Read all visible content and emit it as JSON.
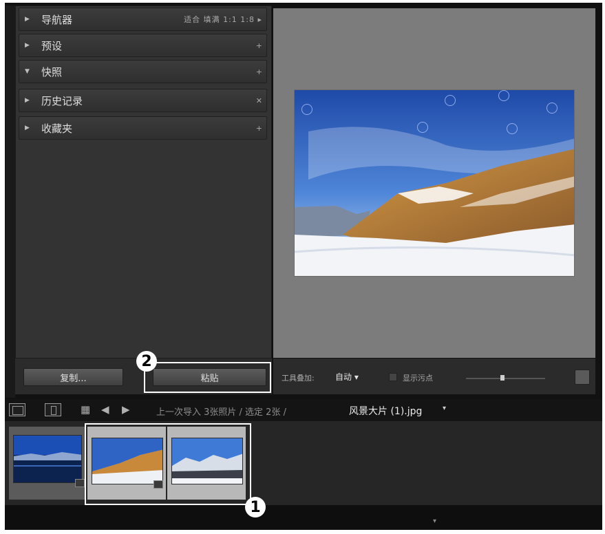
{
  "panels": [
    {
      "label": "导航器",
      "right": "适合 填满 1:1 1:8 ▸"
    },
    {
      "label": "预设",
      "right": "+"
    },
    {
      "label": "快照",
      "right": "+"
    },
    {
      "label": "历史记录",
      "right": "✕"
    },
    {
      "label": "收藏夹",
      "right": "+"
    }
  ],
  "left_toolbar": {
    "copy_label": "复制...",
    "paste_label": "粘贴"
  },
  "preview_toolbar": {
    "tool_label": "工具叠加:",
    "tool_value": "自动 ▾",
    "checkbox_label": "显示污点",
    "grid_icon": "grid-icon"
  },
  "filmstrip_header": {
    "path": "上一次导入 3张照片 / 选定 2张 /",
    "filename": "风景大片 (1).jpg",
    "caret": "▾"
  },
  "callouts": {
    "one": "1",
    "two": "2"
  },
  "bottom": {
    "arrow": "▾"
  }
}
